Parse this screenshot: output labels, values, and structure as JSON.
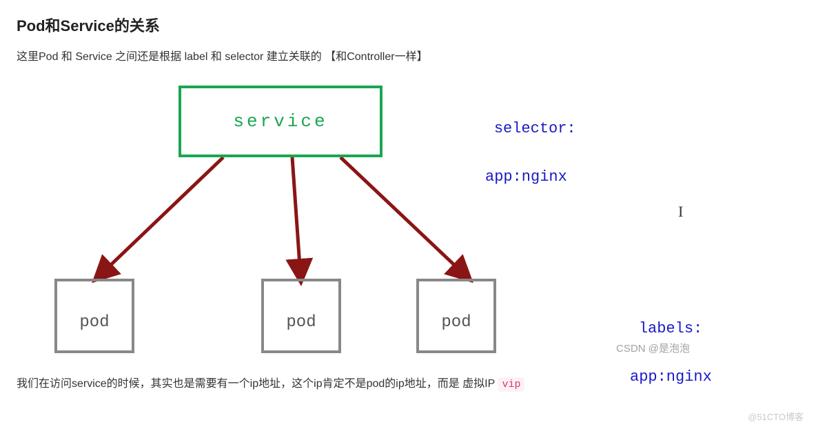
{
  "heading": "Pod和Service的关系",
  "para1": "这里Pod 和 Service 之间还是根据 label 和 selector 建立关联的 【和Controller一样】",
  "diagram": {
    "service_label": "service",
    "pods": [
      "pod",
      "pod",
      "pod"
    ],
    "selector_line1": "selector:",
    "selector_line2": "app:nginx",
    "labels_line1": "labels:",
    "labels_line2": "app:nginx",
    "csdn_watermark": "CSDN @是泡泡"
  },
  "para2_prefix": "我们在访问service的时候，其实也是需要有一个ip地址，这个ip肯定不是pod的ip地址，而是 虚拟IP ",
  "para2_code": "vip",
  "footer_watermark": "@51CTO博客"
}
